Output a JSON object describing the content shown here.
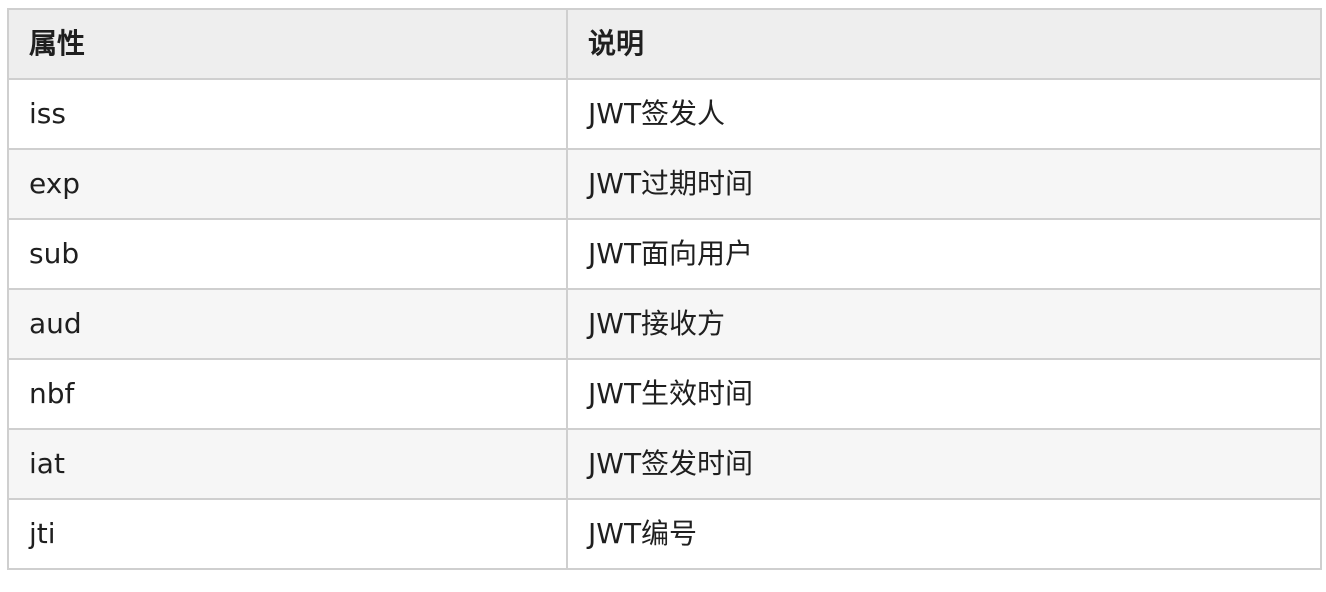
{
  "table": {
    "headers": [
      "属性",
      "说明"
    ],
    "rows": [
      {
        "property": "iss",
        "description": "JWT签发人"
      },
      {
        "property": "exp",
        "description": "JWT过期时间"
      },
      {
        "property": "sub",
        "description": "JWT面向用户"
      },
      {
        "property": "aud",
        "description": "JWT接收方"
      },
      {
        "property": "nbf",
        "description": "JWT生效时间"
      },
      {
        "property": "iat",
        "description": "JWT签发时间"
      },
      {
        "property": "jti",
        "description": "JWT编号"
      }
    ]
  },
  "colors": {
    "header_bg": "#eeeeee",
    "stripe_bg": "#f6f6f6",
    "border": "#cfcfcf",
    "text": "#1f1f1f"
  }
}
